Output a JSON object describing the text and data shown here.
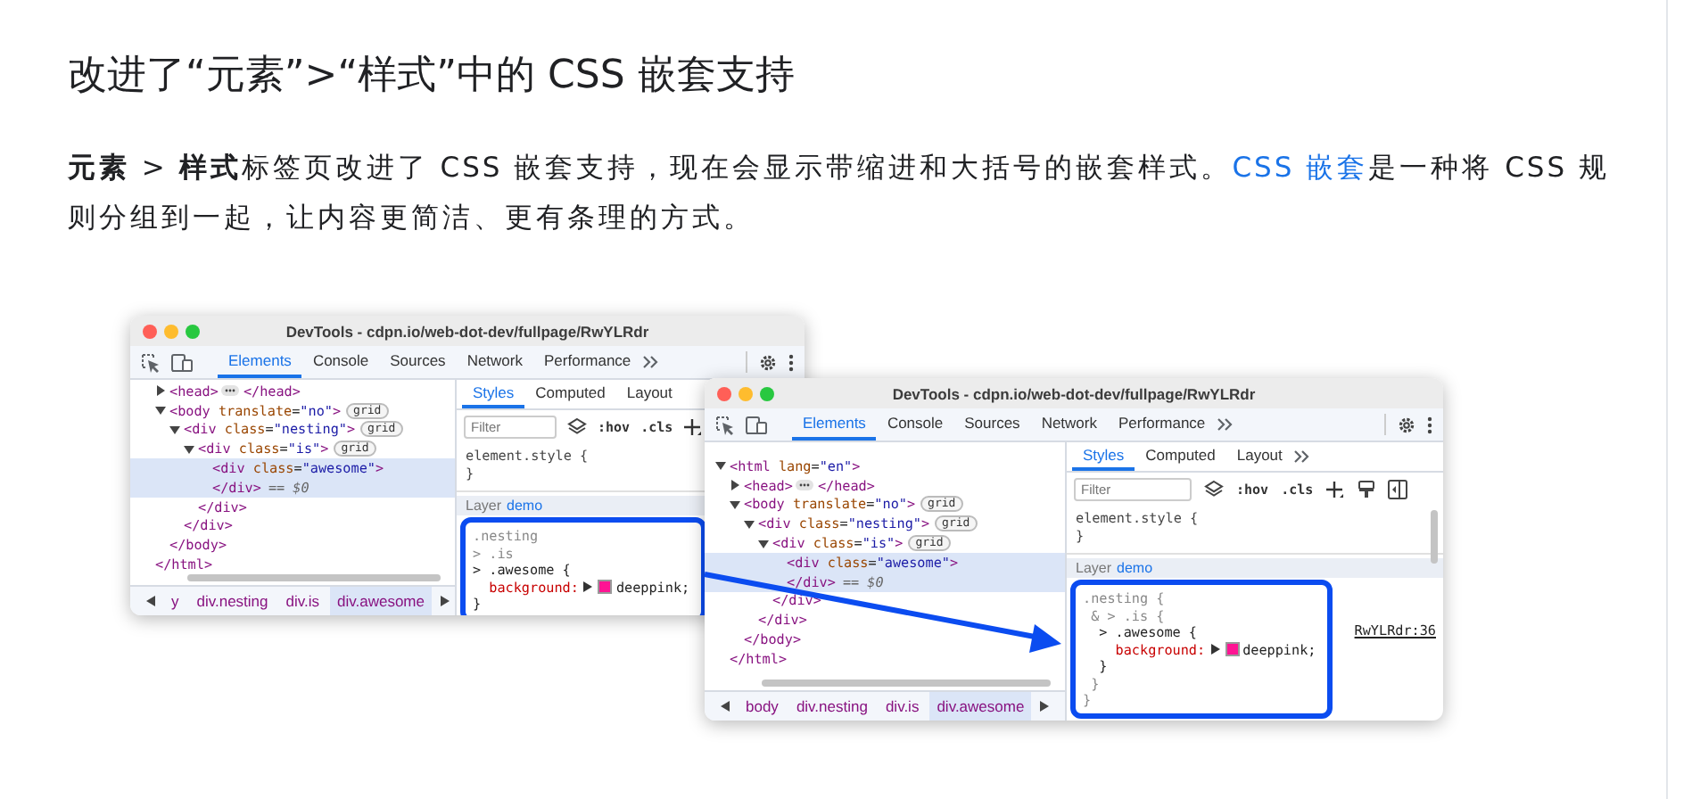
{
  "article": {
    "heading": "改进了“元素”>“样式”中的 CSS 嵌套支持",
    "paragraph": {
      "before": "**元素** > **样式**标签页改进了 CSS 嵌套支持，现在会显示带缩进和大括号的嵌套样式。",
      "link": "CSS 嵌套",
      "after": "是一种将 CSS 规则分组到一起，让内容更简洁、更有条理的方式。"
    }
  },
  "figure": {
    "windows": [
      {
        "title": "DevTools - cdpn.io/web-dot-dev/fullpage/RwYLRdr",
        "tabs": [
          {
            "label": "Elements",
            "selected": true
          },
          {
            "label": "Console",
            "selected": false
          },
          {
            "label": "Sources",
            "selected": false
          },
          {
            "label": "Network",
            "selected": false
          },
          {
            "label": "Performance",
            "selected": false
          }
        ],
        "dom": [
          {
            "children": [
              {
                "text": "<head>",
                "expanded": false,
                "ellipsis": true,
                "close": "</head>",
                "selected": false
              },
              {
                "text": "<body translate=\"no\">",
                "expanded": true,
                "tag": "grid",
                "selected": false,
                "children": [
                  {
                    "text": "<div class=\"nesting\">",
                    "expanded": true,
                    "tag": "grid",
                    "selected": false,
                    "children": [
                      {
                        "text": "<div class=\"is\">",
                        "expanded": true,
                        "tag": "grid",
                        "selected": false,
                        "children": [
                          {
                            "text": "<div class=\"awesome\">",
                            "selected": true
                          },
                          {
                            "text": "</div>",
                            "note": "== $0",
                            "selected": true
                          }
                        ]
                      },
                      {
                        "text": "</div>",
                        "selected": false
                      }
                    ]
                  },
                  {
                    "text": "</div>",
                    "selected": false
                  }
                ]
              },
              {
                "text": "</body>",
                "selected": false
              }
            ]
          },
          {
            "text": "</html>",
            "selected": false
          }
        ],
        "styles": {
          "tabs": [
            {
              "label": "Styles",
              "selected": true
            },
            {
              "label": "Computed",
              "selected": false
            },
            {
              "label": "Layout",
              "selected": false
            }
          ],
          "filter": {
            "placeholder": "Filter"
          },
          "tools": [
            {
              "kind": "layers"
            },
            {
              "kind": "text",
              "label": ":hov"
            },
            {
              "kind": "text",
              "label": ".cls"
            },
            {
              "kind": "plus"
            }
          ],
          "element_style": [
            "element.style {",
            "}"
          ],
          "layer": {
            "label": "Layer",
            "link": "demo"
          },
          "rule": {
            "highlighted": true,
            "lines": [
              {
                "kind": "selector",
                "text": ".nesting",
                "dim": true
              },
              {
                "kind": "selector",
                "text": "> .is",
                "dim": true
              },
              {
                "kind": "selector",
                "text": "> .awesome {",
                "dim": false
              },
              {
                "kind": "declaration",
                "property": "  background:",
                "value": "deeppink;",
                "color": "#ff1493"
              },
              {
                "kind": "selector",
                "text": "}",
                "dim": false
              }
            ]
          }
        },
        "breadcrumbs": [
          {
            "label": "y",
            "selected": false
          },
          {
            "label": "div.nesting",
            "selected": false
          },
          {
            "label": "div.is",
            "selected": false
          },
          {
            "label": "div.awesome",
            "selected": true
          }
        ]
      },
      {
        "title": "DevTools - cdpn.io/web-dot-dev/fullpage/RwYLRdr",
        "tabs": [
          {
            "label": "Elements",
            "selected": true
          },
          {
            "label": "Console",
            "selected": false
          },
          {
            "label": "Sources",
            "selected": false
          },
          {
            "label": "Network",
            "selected": false
          },
          {
            "label": "Performance",
            "selected": false
          }
        ],
        "dom": [
          {
            "text": "<html lang=\"en\">",
            "expanded": true,
            "selected": false,
            "children": [
              {
                "text": "<head>",
                "expanded": false,
                "ellipsis": true,
                "close": "</head>",
                "selected": false
              },
              {
                "text": "<body translate=\"no\">",
                "expanded": true,
                "tag": "grid",
                "selected": false,
                "children": [
                  {
                    "text": "<div class=\"nesting\">",
                    "expanded": true,
                    "tag": "grid",
                    "selected": false,
                    "children": [
                      {
                        "text": "<div class=\"is\">",
                        "expanded": true,
                        "tag": "grid",
                        "selected": false,
                        "children": [
                          {
                            "text": "<div class=\"awesome\">",
                            "selected": true
                          },
                          {
                            "text": "</div>",
                            "note": "== $0",
                            "selected": true
                          }
                        ]
                      },
                      {
                        "text": "</div>",
                        "selected": false
                      }
                    ]
                  },
                  {
                    "text": "</div>",
                    "selected": false
                  }
                ]
              },
              {
                "text": "</body>",
                "selected": false
              }
            ]
          },
          {
            "text": "</html>",
            "selected": false
          }
        ],
        "styles": {
          "tabs": [
            {
              "label": "Styles",
              "selected": true
            },
            {
              "label": "Computed",
              "selected": false
            },
            {
              "label": "Layout",
              "selected": false
            }
          ],
          "more": true,
          "filter": {
            "placeholder": "Filter"
          },
          "tools": [
            {
              "kind": "layers"
            },
            {
              "kind": "text",
              "label": ":hov"
            },
            {
              "kind": "text",
              "label": ".cls"
            },
            {
              "kind": "plus"
            },
            {
              "kind": "paint"
            },
            {
              "kind": "sidebar"
            }
          ],
          "element_style": [
            "element.style {",
            "}"
          ],
          "layer": {
            "label": "Layer",
            "link": "demo"
          },
          "rule": {
            "highlighted": true,
            "source": "RwYLRdr:36",
            "lines": [
              {
                "kind": "selector",
                "text": ".nesting {",
                "dim": true
              },
              {
                "kind": "selector",
                "text": " & > .is {",
                "dim": true
              },
              {
                "kind": "selector",
                "text": "  > .awesome {",
                "dim": false
              },
              {
                "kind": "declaration",
                "property": "    background:",
                "value": "deeppink;",
                "color": "#ff1493"
              },
              {
                "kind": "selector",
                "text": "  }",
                "dim": false
              },
              {
                "kind": "selector",
                "text": " }",
                "dim": true
              },
              {
                "kind": "selector",
                "text": "}",
                "dim": true
              }
            ]
          }
        },
        "breadcrumbs": [
          {
            "label": "body",
            "selected": false
          },
          {
            "label": "div.nesting",
            "selected": false
          },
          {
            "label": "div.is",
            "selected": false
          },
          {
            "label": "div.awesome",
            "selected": true
          }
        ]
      }
    ]
  }
}
